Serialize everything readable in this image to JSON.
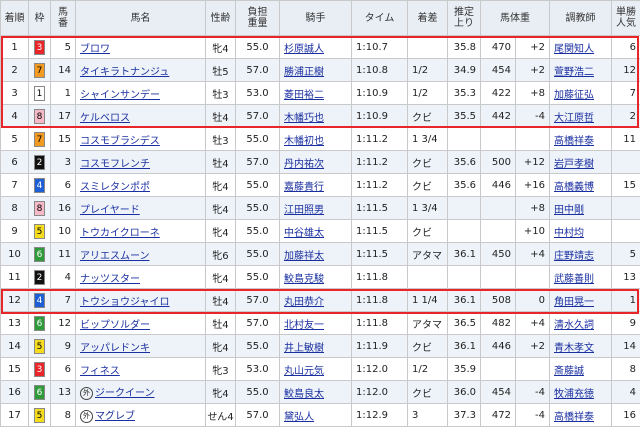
{
  "headers": {
    "rank": "着順",
    "waku": "枠",
    "uma1": "馬",
    "uma2": "番",
    "name": "馬名",
    "sexage": "性齢",
    "weight1": "負担",
    "weight2": "重量",
    "jockey": "騎手",
    "time": "タイム",
    "margin": "着差",
    "last1": "推定",
    "last2": "上り",
    "bodyweight": "馬体重",
    "trainer": "調教師",
    "pop1": "単勝",
    "pop2": "人気"
  },
  "waku_colors": {
    "1": {
      "bg": "#ffffff",
      "fg": "#000000"
    },
    "2": {
      "bg": "#111111",
      "fg": "#ffffff"
    },
    "3": {
      "bg": "#e8262a",
      "fg": "#ffffff"
    },
    "4": {
      "bg": "#1e5fd6",
      "fg": "#ffffff"
    },
    "5": {
      "bg": "#f5dc1c",
      "fg": "#000000"
    },
    "6": {
      "bg": "#2e9a3a",
      "fg": "#ffffff"
    },
    "7": {
      "bg": "#f39a22",
      "fg": "#000000"
    },
    "8": {
      "bg": "#f7b8c8",
      "fg": "#000000"
    }
  },
  "highlight_color": "#e8262a",
  "rows": [
    {
      "rank": "1",
      "waku": "3",
      "num": "5",
      "name": "ブロワ",
      "mark": "",
      "sexage": "牝4",
      "weight": "55.0",
      "jockey": "杉原誠人",
      "time": "1:10.7",
      "margin": "",
      "last3f": "35.8",
      "bw": "470",
      "bwdiff": "+2",
      "trainer": "尾関知人",
      "pop": "6"
    },
    {
      "rank": "2",
      "waku": "7",
      "num": "14",
      "name": "タイキラトナンジュ",
      "mark": "",
      "sexage": "牡5",
      "weight": "57.0",
      "jockey": "勝浦正樹",
      "time": "1:10.8",
      "margin": "1/2",
      "last3f": "34.9",
      "bw": "454",
      "bwdiff": "+2",
      "trainer": "萱野浩二",
      "pop": "12"
    },
    {
      "rank": "3",
      "waku": "1",
      "num": "1",
      "name": "シャインサンデー",
      "mark": "",
      "sexage": "牡3",
      "weight": "53.0",
      "jockey": "菱田裕二",
      "time": "1:10.9",
      "margin": "1/2",
      "last3f": "35.3",
      "bw": "422",
      "bwdiff": "+8",
      "trainer": "加藤征弘",
      "pop": "7"
    },
    {
      "rank": "4",
      "waku": "8",
      "num": "17",
      "name": "ケルベロス",
      "mark": "",
      "sexage": "牡4",
      "weight": "57.0",
      "jockey": "木幡巧也",
      "time": "1:10.9",
      "margin": "クビ",
      "last3f": "35.5",
      "bw": "442",
      "bwdiff": "-4",
      "trainer": "大江原哲",
      "pop": "2"
    },
    {
      "rank": "5",
      "waku": "7",
      "num": "15",
      "name": "コスモブラシデス",
      "mark": "",
      "sexage": "牡3",
      "weight": "55.0",
      "jockey": "木幡初也",
      "time": "1:11.2",
      "margin": "1 3/4",
      "last3f": "",
      "bw": "",
      "bwdiff": "",
      "trainer": "高橋祥泰",
      "pop": "11"
    },
    {
      "rank": "6",
      "waku": "2",
      "num": "3",
      "name": "コスモフレンチ",
      "mark": "",
      "sexage": "牡4",
      "weight": "57.0",
      "jockey": "丹内祐次",
      "time": "1:11.2",
      "margin": "クビ",
      "last3f": "35.6",
      "bw": "500",
      "bwdiff": "+12",
      "trainer": "岩戸孝樹",
      "pop": ""
    },
    {
      "rank": "7",
      "waku": "4",
      "num": "6",
      "name": "スミレタンポポ",
      "mark": "",
      "sexage": "牝4",
      "weight": "55.0",
      "jockey": "嘉藤貴行",
      "time": "1:11.2",
      "margin": "クビ",
      "last3f": "35.6",
      "bw": "446",
      "bwdiff": "+16",
      "trainer": "高橋義博",
      "pop": "15"
    },
    {
      "rank": "8",
      "waku": "8",
      "num": "16",
      "name": "プレイヤード",
      "mark": "",
      "sexage": "牝4",
      "weight": "55.0",
      "jockey": "江田照男",
      "time": "1:11.5",
      "margin": "1 3/4",
      "last3f": "",
      "bw": "",
      "bwdiff": "+8",
      "trainer": "田中剛",
      "pop": ""
    },
    {
      "rank": "9",
      "waku": "5",
      "num": "10",
      "name": "トウカイクローネ",
      "mark": "",
      "sexage": "牝4",
      "weight": "55.0",
      "jockey": "中谷雄太",
      "time": "1:11.5",
      "margin": "クビ",
      "last3f": "",
      "bw": "",
      "bwdiff": "+10",
      "trainer": "中村均",
      "pop": ""
    },
    {
      "rank": "10",
      "waku": "6",
      "num": "11",
      "name": "アリエスムーン",
      "mark": "",
      "sexage": "牝6",
      "weight": "55.0",
      "jockey": "加藤祥太",
      "time": "1:11.5",
      "margin": "アタマ",
      "last3f": "36.1",
      "bw": "450",
      "bwdiff": "+4",
      "trainer": "庄野靖志",
      "pop": "5"
    },
    {
      "rank": "11",
      "waku": "2",
      "num": "4",
      "name": "ナッツスター",
      "mark": "",
      "sexage": "牝4",
      "weight": "55.0",
      "jockey": "鮫島克駿",
      "time": "1:11.8",
      "margin": "",
      "last3f": "",
      "bw": "",
      "bwdiff": "",
      "trainer": "武藤善則",
      "pop": "13"
    },
    {
      "rank": "12",
      "waku": "4",
      "num": "7",
      "name": "トウショウジャイロ",
      "mark": "",
      "sexage": "牡4",
      "weight": "57.0",
      "jockey": "丸田恭介",
      "time": "1:11.8",
      "margin": "1 1/4",
      "last3f": "36.1",
      "bw": "508",
      "bwdiff": "0",
      "trainer": "角田晃一",
      "pop": "1"
    },
    {
      "rank": "13",
      "waku": "6",
      "num": "12",
      "name": "ビップソルダー",
      "mark": "",
      "sexage": "牡4",
      "weight": "57.0",
      "jockey": "北村友一",
      "time": "1:11.8",
      "margin": "アタマ",
      "last3f": "36.5",
      "bw": "482",
      "bwdiff": "+4",
      "trainer": "清水久詞",
      "pop": "9"
    },
    {
      "rank": "14",
      "waku": "5",
      "num": "9",
      "name": "アッパレドンキ",
      "mark": "",
      "sexage": "牝4",
      "weight": "55.0",
      "jockey": "井上敏樹",
      "time": "1:11.9",
      "margin": "クビ",
      "last3f": "36.1",
      "bw": "446",
      "bwdiff": "+2",
      "trainer": "青木孝文",
      "pop": "14"
    },
    {
      "rank": "15",
      "waku": "3",
      "num": "6",
      "name": "フィネス",
      "mark": "",
      "sexage": "牝3",
      "weight": "53.0",
      "jockey": "丸山元気",
      "time": "1:12.0",
      "margin": "1/2",
      "last3f": "35.9",
      "bw": "",
      "bwdiff": "",
      "trainer": "斎藤誠",
      "pop": "8"
    },
    {
      "rank": "16",
      "waku": "6",
      "num": "13",
      "name": "ジークイーン",
      "mark": "外",
      "sexage": "牝4",
      "weight": "55.0",
      "jockey": "鮫島良太",
      "time": "1:12.0",
      "margin": "クビ",
      "last3f": "36.0",
      "bw": "454",
      "bwdiff": "-4",
      "trainer": "牧浦充徳",
      "pop": "4"
    },
    {
      "rank": "17",
      "waku": "5",
      "num": "8",
      "name": "マグレブ",
      "mark": "外",
      "sexage": "せん4",
      "weight": "57.0",
      "jockey": "黛弘人",
      "time": "1:12.9",
      "margin": "3",
      "last3f": "37.3",
      "bw": "472",
      "bwdiff": "-4",
      "trainer": "高橋祥泰",
      "pop": "16"
    }
  ]
}
